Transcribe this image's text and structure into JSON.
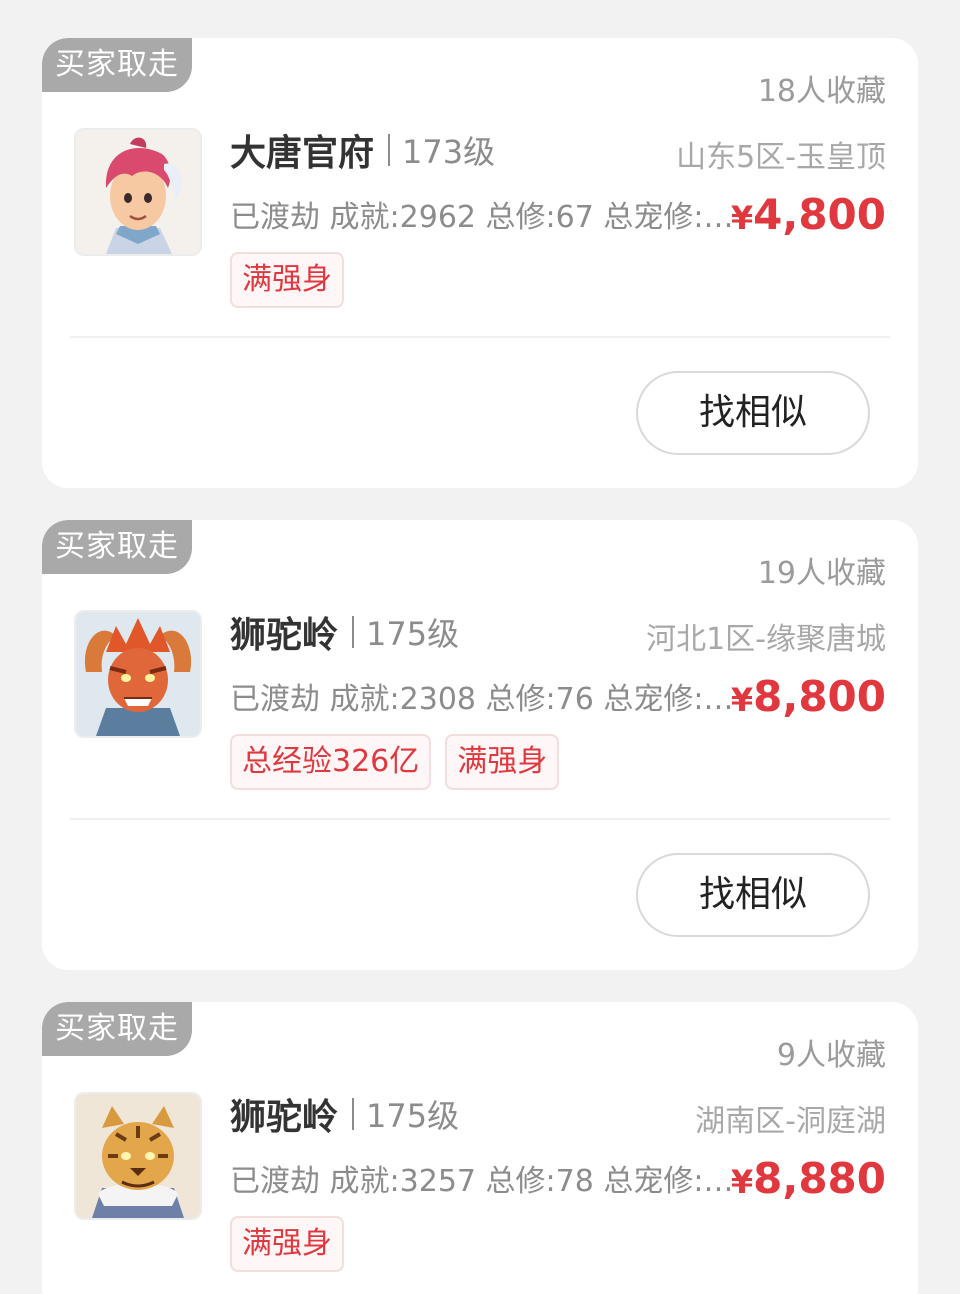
{
  "listings": [
    {
      "badge": "买家取走",
      "favorites": "18人收藏",
      "school": "大唐官府",
      "level": "173级",
      "server": "山东5区-玉皇顶",
      "desc": "已渡劫 成就:2962 总修:67 总宠修:…",
      "price_symbol": "¥",
      "price": "4,800",
      "tags": [
        "满强身"
      ],
      "avatar_icon": "datang-character-avatar-icon",
      "button": "找相似"
    },
    {
      "badge": "买家取走",
      "favorites": "19人收藏",
      "school": "狮驼岭",
      "level": "175级",
      "server": "河北1区-缘聚唐城",
      "desc": "已渡劫 成就:2308 总修:76 总宠修:…",
      "price_symbol": "¥",
      "price": "8,800",
      "tags": [
        "总经验326亿",
        "满强身"
      ],
      "avatar_icon": "shituo-red-demon-avatar-icon",
      "button": "找相似"
    },
    {
      "badge": "买家取走",
      "favorites": "9人收藏",
      "school": "狮驼岭",
      "level": "175级",
      "server": "湖南区-洞庭湖",
      "desc": "已渡劫 成就:3257 总修:78 总宠修:…",
      "price_symbol": "¥",
      "price": "8,880",
      "tags": [
        "满强身"
      ],
      "avatar_icon": "shituo-tiger-avatar-icon"
    }
  ],
  "colors": {
    "price": "#e0383e",
    "badge_bg": "#a9a9a9",
    "page_bg": "#f2f2f2"
  }
}
